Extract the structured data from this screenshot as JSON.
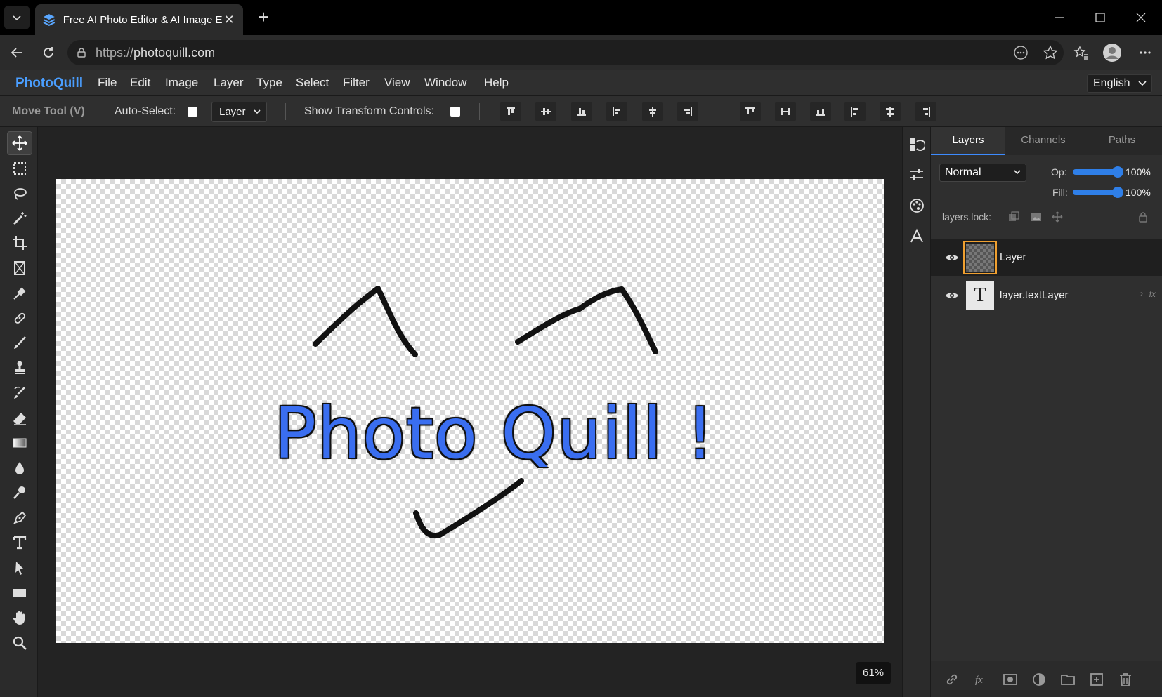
{
  "browser": {
    "tab_title": "Free AI Photo Editor & AI Image Ed",
    "url_scheme": "https://",
    "url_host": "photoquill.com"
  },
  "app": {
    "brand": "PhotoQuill",
    "menu": [
      "File",
      "Edit",
      "Image",
      "Layer",
      "Type",
      "Select",
      "Filter",
      "View",
      "Window",
      "Help"
    ],
    "language": "English"
  },
  "options": {
    "tool_name": "Move Tool (V)",
    "auto_select_label": "Auto-Select:",
    "auto_select_target": "Layer",
    "transform_label": "Show Transform Controls:"
  },
  "canvas": {
    "text": "Photo Quill !",
    "text_color": "#3a6ef0",
    "zoom": "61%"
  },
  "layers_panel": {
    "tabs": [
      "Layers",
      "Channels",
      "Paths"
    ],
    "active_tab": "Layers",
    "blend_mode": "Normal",
    "opacity_label": "Op:",
    "opacity_value": "100%",
    "fill_label": "Fill:",
    "fill_value": "100%",
    "lock_label": "layers.lock:",
    "layers": [
      {
        "name": "Layer",
        "type": "raster",
        "visible": true,
        "selected": true
      },
      {
        "name": "layer.textLayer",
        "type": "text",
        "visible": true,
        "selected": false,
        "fx": "fx",
        "thumb_glyph": "T"
      }
    ]
  },
  "colors": {
    "accent": "#3d8bff",
    "brand": "#4a9eff",
    "selection_outline": "#f0a030"
  }
}
